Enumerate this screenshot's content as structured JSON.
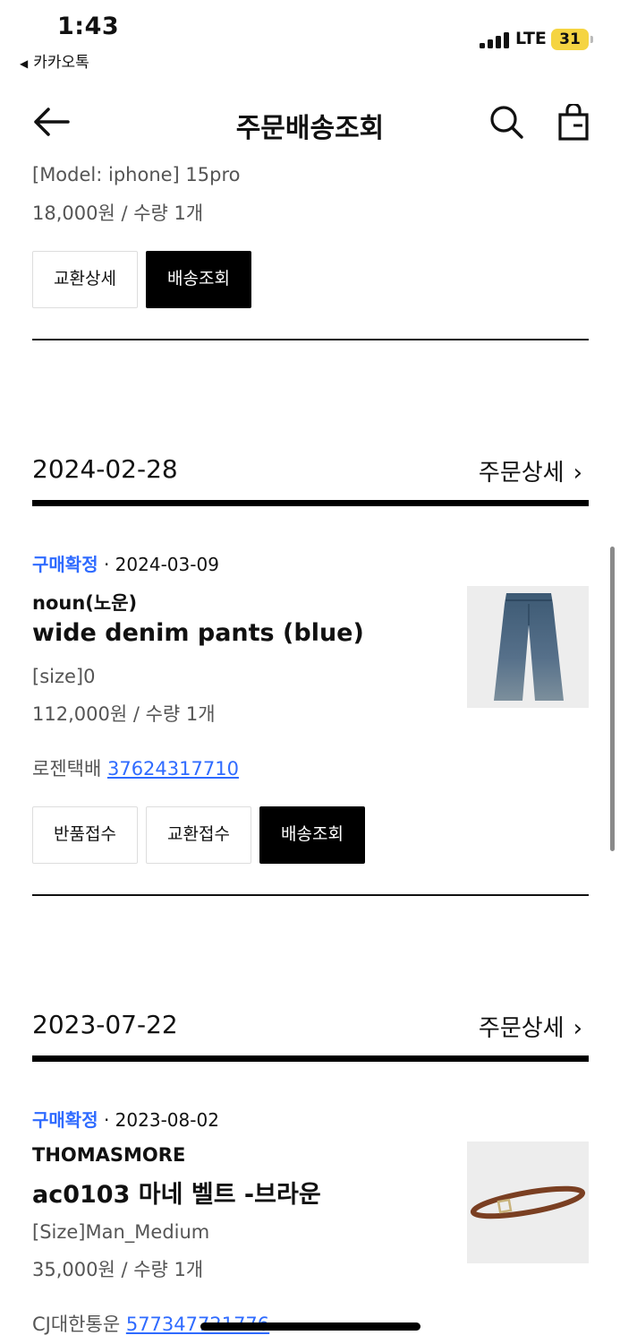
{
  "status_bar": {
    "time": "1:43",
    "back_app": "카카오톡",
    "network": "LTE",
    "battery": "31"
  },
  "header": {
    "title": "주문배송조회",
    "icons": [
      "back-arrow-icon",
      "search-icon",
      "shopping-bag-icon"
    ]
  },
  "partial_item": {
    "option": "[Model: iphone] 15pro",
    "price_qty": "18,000원 / 수량 1개",
    "buttons": [
      "교환상세",
      "배송조회"
    ]
  },
  "orders": [
    {
      "date": "2024-02-28",
      "detail_label": "주문상세",
      "item": {
        "state": "구매확정",
        "state_date": " · 2024-03-09",
        "brand": "noun(노운)",
        "name": "wide denim pants (blue)",
        "option": "[size]0",
        "price_qty": "112,000원 / 수량 1개",
        "courier": "로젠택배",
        "tracking": "37624317710",
        "buttons": [
          "반품접수",
          "교환접수",
          "배송조회"
        ]
      }
    },
    {
      "date": "2023-07-22",
      "detail_label": "주문상세",
      "item": {
        "state": "구매확정",
        "state_date": " · 2023-08-02",
        "brand": "THOMASMORE",
        "name": "ac0103 마네 벨트 -브라운",
        "option": "[Size]Man_Medium",
        "price_qty": "35,000원 / 수량 1개",
        "courier": "CJ대한통운",
        "tracking": "577347721776"
      }
    }
  ],
  "colors": {
    "accent": "#2f6bff",
    "primary_button": "#000000",
    "battery": "#f5d442"
  }
}
